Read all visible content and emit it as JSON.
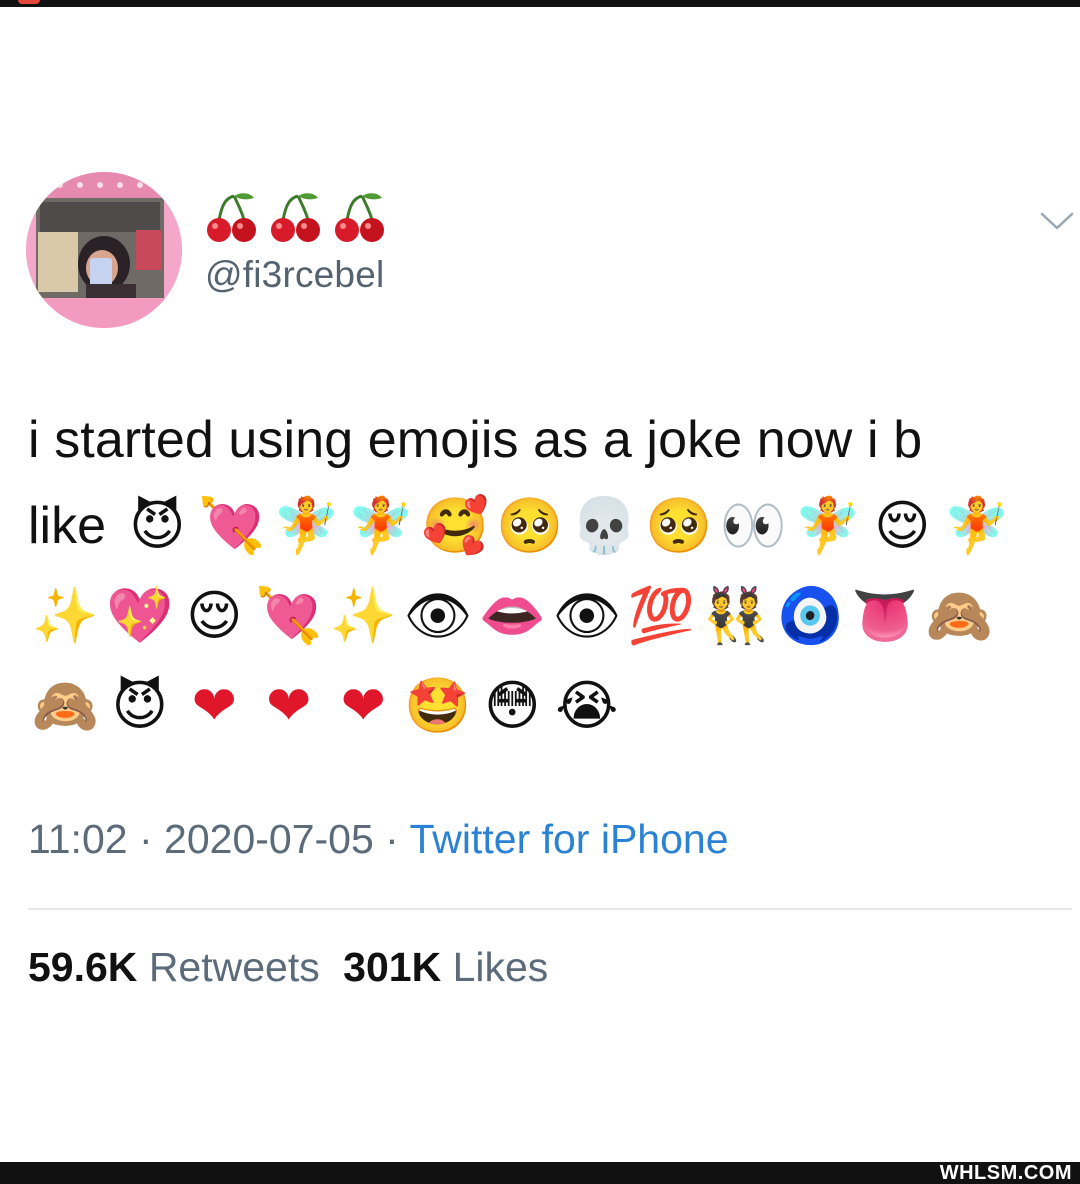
{
  "tweet": {
    "display_name_icons": [
      "cherries-icon",
      "cherries-icon",
      "cherries-icon"
    ],
    "handle": "@fi3rcebel",
    "text_line1": "i started using emojis as a joke now i b",
    "text_line2_word": "like",
    "emoji_rows": [
      [
        "😈",
        "💘",
        "🧚",
        "🧚",
        "🥰",
        "🥺",
        "💀",
        "🥺",
        "👀",
        "🧚",
        "😌",
        "🧚"
      ],
      [
        "✨",
        "💖",
        "😌",
        "💘",
        "✨",
        "👁",
        "👄",
        "👁",
        "💯",
        "👯",
        "🧿",
        "👅",
        "🙈"
      ],
      [
        "🙈",
        "😈",
        "❤",
        "❤",
        "❤",
        "🤩",
        "😳",
        "😭"
      ]
    ],
    "time": "11:02",
    "separator": "·",
    "date": "2020-07-05",
    "source": "Twitter for iPhone",
    "retweets_count": "59.6K",
    "retweets_label": "Retweets",
    "likes_count": "301K",
    "likes_label": "Likes"
  },
  "watermark": "WHLSM.COM",
  "colors": {
    "text": "#111111",
    "secondary": "#5b6b7a",
    "link": "#2b82d4",
    "divider": "#e4e8ec"
  }
}
